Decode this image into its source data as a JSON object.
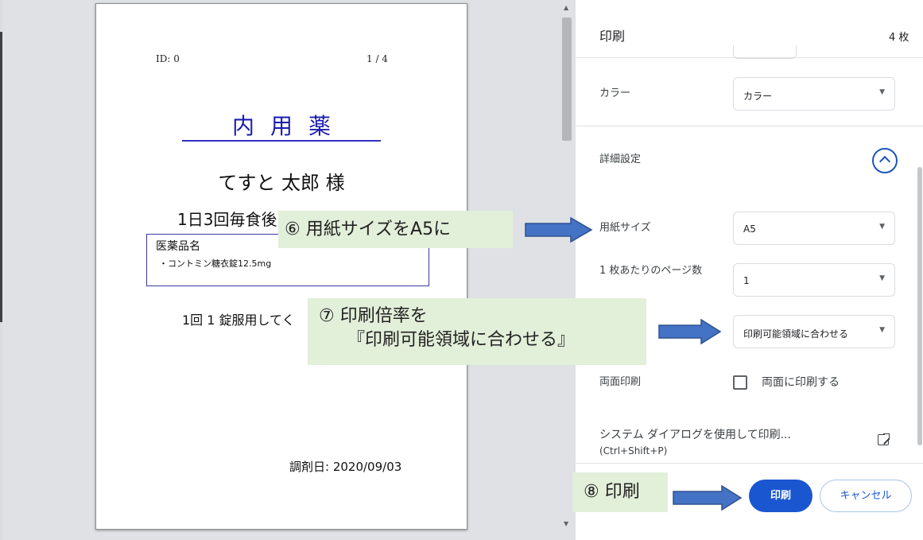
{
  "preview": {
    "id_label": "ID: 0",
    "page_number": "1 / 4",
    "title": "内用薬",
    "patient_name": "てすと 太郎 様",
    "dosage": "1日3回毎食後",
    "drug_header": "医薬品名",
    "drug_item": "・コントミン糖衣錠12.5mg",
    "instruction": "1回 1 錠服用してく",
    "dispense_date": "調剤日: 2020/09/03"
  },
  "panel": {
    "title": "印刷",
    "sheet_count": "4 枚",
    "color": {
      "label": "カラー",
      "value": "カラー"
    },
    "advanced": {
      "label": "詳細設定"
    },
    "paper_size": {
      "label": "用紙サイズ",
      "value": "A5"
    },
    "pages_per_sheet": {
      "label": "1 枚あたりのページ数",
      "value": "1"
    },
    "scale": {
      "value": "印刷可能領域に合わせる"
    },
    "duplex": {
      "label": "両面印刷",
      "checkbox_label": "両面に印刷する"
    },
    "system_dialog": {
      "label": "システム ダイアログを使用して印刷...",
      "shortcut": "(Ctrl+Shift+P)"
    },
    "print_button": "印刷",
    "cancel_button": "キャンセル"
  },
  "annotations": {
    "step6": "⑥ 用紙サイズをA5に",
    "step7_line1": "⑦ 印刷倍率を",
    "step7_line2": "『印刷可能領域に合わせる』",
    "step8": "⑧ 印刷"
  },
  "colors": {
    "accent": "#1a56d0",
    "title_blue": "#1c1cb0",
    "callout_bg": "#e2efd9",
    "arrow_fill": "#4472c4"
  }
}
